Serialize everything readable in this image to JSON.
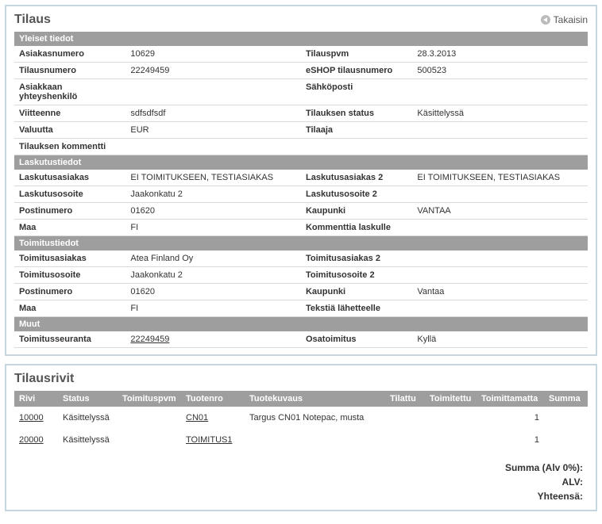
{
  "order": {
    "title": "Tilaus",
    "back_label": "Takaisin",
    "sections": {
      "general": {
        "heading": "Yleiset tiedot",
        "customer_number_label": "Asiakasnumero",
        "customer_number": "10629",
        "order_date_label": "Tilauspvm",
        "order_date": "28.3.2013",
        "order_number_label": "Tilausnumero",
        "order_number": "22249459",
        "eshop_number_label": "eSHOP tilausnumero",
        "eshop_number": "500523",
        "contact_label": "Asiakkaan yhteyshenkilö",
        "contact": "",
        "email_label": "Sähköposti",
        "email": "",
        "reference_label": "Viitteenne",
        "reference": "sdfsdfsdf",
        "status_label": "Tilauksen status",
        "status": "Käsittelyssä",
        "currency_label": "Valuutta",
        "currency": "EUR",
        "orderer_label": "Tilaaja",
        "orderer": "",
        "comment_label": "Tilauksen kommentti",
        "comment": ""
      },
      "billing": {
        "heading": "Laskutustiedot",
        "customer_label": "Laskutusasiakas",
        "customer": "EI TOIMITUKSEEN, TESTIASIAKAS",
        "customer2_label": "Laskutusasiakas 2",
        "customer2": "EI TOIMITUKSEEN, TESTIASIAKAS",
        "address_label": "Laskutusosoite",
        "address": "Jaakonkatu 2",
        "address2_label": "Laskutusosoite 2",
        "address2": "",
        "postal_label": "Postinumero",
        "postal": "01620",
        "city_label": "Kaupunki",
        "city": "VANTAA",
        "country_label": "Maa",
        "country": "FI",
        "invoice_comment_label": "Kommenttia laskulle",
        "invoice_comment": ""
      },
      "delivery": {
        "heading": "Toimitustiedot",
        "customer_label": "Toimitusasiakas",
        "customer": "Atea Finland Oy",
        "customer2_label": "Toimitusasiakas 2",
        "customer2": "",
        "address_label": "Toimitusosoite",
        "address": "Jaakonkatu 2",
        "address2_label": "Toimitusosoite 2",
        "address2": "",
        "postal_label": "Postinumero",
        "postal": "01620",
        "city_label": "Kaupunki",
        "city": "Vantaa",
        "country_label": "Maa",
        "country": "FI",
        "note_label": "Tekstiä lähetteelle",
        "note": ""
      },
      "other": {
        "heading": "Muut",
        "tracking_label": "Toimitusseuranta",
        "tracking": "22249459",
        "partial_label": "Osatoimitus",
        "partial": "Kyllä"
      }
    }
  },
  "lines": {
    "title": "Tilausrivit",
    "columns": {
      "row": "Rivi",
      "status": "Status",
      "delivery_date": "Toimituspvm",
      "product_no": "Tuotenro",
      "description": "Tuotekuvaus",
      "ordered": "Tilattu",
      "delivered": "Toimitettu",
      "undelivered": "Toimittamatta",
      "sum": "Summa"
    },
    "rows": [
      {
        "row": "10000",
        "status": "Käsittelyssä",
        "delivery_date": "",
        "product_no": "CN01",
        "description": "Targus CN01 Notepac, musta",
        "ordered": "",
        "delivered": "",
        "undelivered": "1",
        "sum": ""
      },
      {
        "row": "20000",
        "status": "Käsittelyssä",
        "delivery_date": "",
        "product_no": "TOIMITUS1",
        "description": "",
        "ordered": "",
        "delivered": "",
        "undelivered": "1",
        "sum": ""
      }
    ],
    "totals": {
      "subtotal_label": "Summa (Alv 0%):",
      "subtotal": "",
      "vat_label": "ALV:",
      "vat": "",
      "total_label": "Yhteensä:",
      "total": ""
    }
  }
}
